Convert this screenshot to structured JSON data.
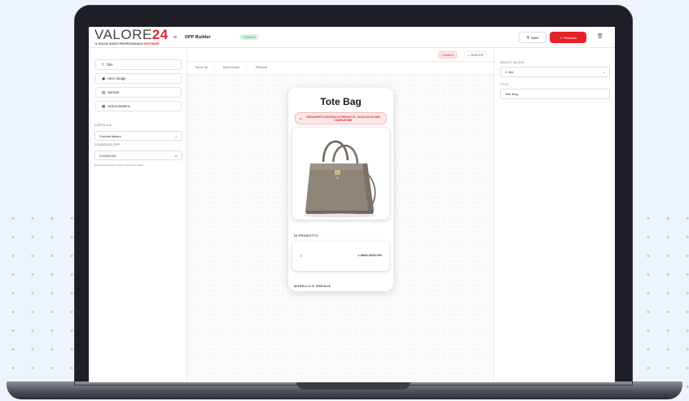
{
  "app": {
    "logo_text": "VALORE",
    "logo_number": "24",
    "logo_tagline": "IL DOLCE GUSTO PROFESSIONALE",
    "logo_tagline_accent": "SOFTWARE",
    "title": "DPP Builder",
    "status_pill": "Published",
    "save_label": "Save",
    "publish_label": "Pubblica"
  },
  "left_sidebar": {
    "blocks": [
      {
        "label": "Title",
        "icon": "text-icon"
      },
      {
        "label": "Hero Image",
        "icon": "image-icon"
      },
      {
        "label": "Section",
        "icon": "section-icon"
      },
      {
        "label": "Action Buttons",
        "icon": "buttons-icon"
      }
    ],
    "folder_label": "CARTELLA",
    "folder_value": "Prodotti Italiani",
    "expiry_label": "SCADENZA DPP",
    "expiry_value": "01/05/2026",
    "hint": "Dopo questa data il DPP risulterà non attivo"
  },
  "canvas": {
    "view_mobile": "MOBILE",
    "view_desktop": "DESKTOP",
    "actions": [
      "Move Up",
      "Move Down",
      "Remove"
    ]
  },
  "preview": {
    "title": "Tote Bag",
    "warning": "PASSAPORTO DIGITALE DI PRODOTTO - BLOCCO DA NON COMPLETARE",
    "section_product_id": "ID PRODOTTO",
    "product_code": "L-BAG-2024-001",
    "section_model": "MODELLO E SERIALE"
  },
  "right_panel": {
    "select_label": "SELECT BLOCK",
    "select_value": "1. title",
    "title_label": "TITLE",
    "title_value": "Tote Bag"
  },
  "colors": {
    "accent": "#e3262d",
    "bag": "#8d8578"
  }
}
